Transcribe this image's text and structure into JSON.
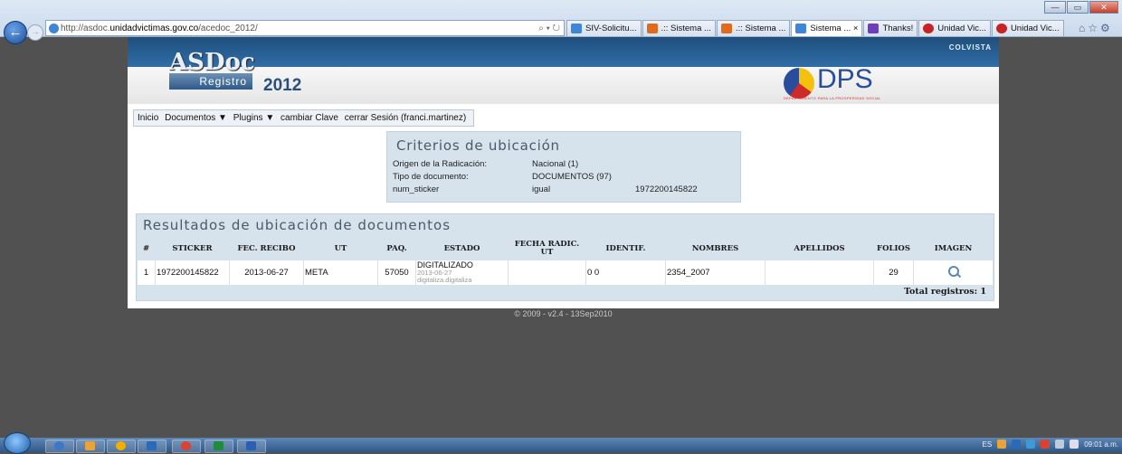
{
  "browser": {
    "url_prefix": "http://asdoc.",
    "url_host": "unidadvictimas.gov.co",
    "url_path": "/acedoc_2012/",
    "address_tools": "⌕ ▾ ↻",
    "tabs": [
      {
        "label": "SIV-Solicitu...",
        "icon_color": "#3f86d6"
      },
      {
        "label": ".:: Sistema ...",
        "icon_color": "#e06a1e"
      },
      {
        "label": ".:: Sistema ...",
        "icon_color": "#e06a1e"
      },
      {
        "label": "Sistema ... ×",
        "icon_color": "#3f86d6"
      },
      {
        "label": "Thanks!",
        "icon_color": "#6b3fb5"
      },
      {
        "label": "Unidad Vic...",
        "icon_color": "#c82222"
      },
      {
        "label": "Unidad Vic...",
        "icon_color": "#c82222"
      }
    ],
    "window_controls": {
      "minimize": "—",
      "maximize": "▭",
      "close": "✕"
    }
  },
  "header": {
    "logo_text": "ASDoc",
    "logo_sub": "Registro",
    "year": "2012",
    "colvista": "COLVISTA",
    "dps_text": "DPS",
    "dps_sub": "DEPARTAMENTO PARA LA PROSPERIDAD SOCIAL"
  },
  "menu": {
    "items": [
      "Inicio",
      "Documentos ▼",
      "Plugins ▼",
      "cambiar Clave",
      "cerrar Sesión (franci.martinez)"
    ]
  },
  "criterios": {
    "title": "Criterios de ubicación",
    "rows": [
      {
        "label": "Origen de la Radicación:",
        "value": "Nacional (1)",
        "extra": ""
      },
      {
        "label": "Tipo de documento:",
        "value": "DOCUMENTOS (97)",
        "extra": ""
      },
      {
        "label": "num_sticker",
        "value": "igual",
        "extra": "1972200145822"
      }
    ]
  },
  "resultados": {
    "title": "Resultados de ubicación de documentos",
    "columns": [
      "#",
      "Sticker",
      "Fec. Recibo",
      "UT",
      "Paq.",
      "Estado",
      "Fecha Radic. UT",
      "Identif.",
      "Nombres",
      "Apellidos",
      "Folios",
      "Imagen"
    ],
    "rows": [
      {
        "num": "1",
        "sticker": "1972200145822",
        "fec_recibo": "2013-06-27",
        "ut": "META",
        "paq": "57050",
        "estado": "DIGITALIZADO",
        "estado_fecha": "2013-06-27",
        "estado_user": "digitaliza.digitaliza",
        "fecha_radic": "",
        "identif": "0 0",
        "nombres": "2354_2007",
        "apellidos": "",
        "folios": "29"
      }
    ],
    "total": "Total registros: 1"
  },
  "footer": "© 2009 - v2.4 - 13Sep2010",
  "taskbar": {
    "lang": "ES",
    "clock": "09:01 a.m.",
    "apps": [
      "#3c78c8",
      "#e8a33a",
      "#f0b000",
      "#2a6ab8",
      "#d9432f",
      "#1f8b3f",
      "#2b5fb3"
    ]
  },
  "colors": {
    "panel": "#d7e3ec",
    "banner": "#2e6aa3",
    "background": "#515151"
  }
}
